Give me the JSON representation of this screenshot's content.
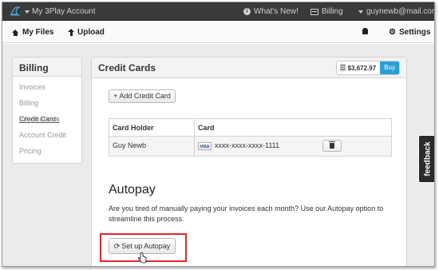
{
  "topbar": {
    "account_label": "My 3Play Account",
    "whats_new_label": "What's New!",
    "billing_label": "Billing",
    "user_email": "guynewb@mail.com"
  },
  "subnav": {
    "my_files_label": "My Files",
    "upload_label": "Upload",
    "settings_label": "Settings"
  },
  "sidebar": {
    "title": "Billing",
    "items": [
      {
        "label": "Invoices"
      },
      {
        "label": "Billing Information"
      },
      {
        "label": "Credit Cards"
      },
      {
        "label": "Account Credit"
      },
      {
        "label": "Pricing"
      }
    ],
    "active_item": "Credit Cards"
  },
  "panel": {
    "title": "Credit Cards",
    "balance": "$3,672.97",
    "buy_label": "Buy",
    "add_card_label": "+ Add Credit Card",
    "table": {
      "headers": [
        "Card Holder",
        "Card"
      ],
      "rows": [
        {
          "holder": "Guy Newb",
          "card_brand": "VISA",
          "card_number": "xxxx-xxxx-xxxx-1111"
        }
      ]
    },
    "autopay": {
      "heading": "Autopay",
      "description": "Are you tired of manually paying your invoices each month? Use our Autopay option to streamline this process.",
      "button_label": "Set up Autopay"
    }
  },
  "feedback_label": "feedback",
  "colors": {
    "topbar_bg": "#3a3a3a",
    "accent_blue": "#2a9fd6",
    "highlight_red": "#e0262a"
  }
}
